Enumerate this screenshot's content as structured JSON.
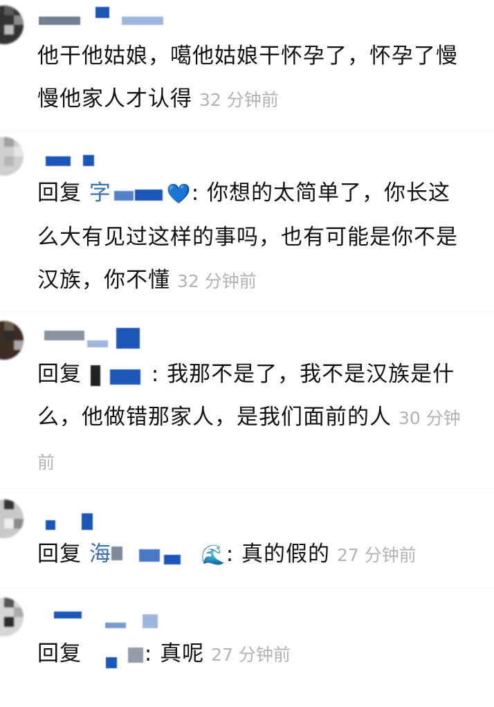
{
  "comments": [
    {
      "text": "他干他姑娘，噶他姑娘干怀孕了，怀孕了慢慢他家人才认得",
      "time": "32 分钟前"
    },
    {
      "reply_label": "回复",
      "reply_target_char": "字",
      "reply_emoji": "💙",
      "text": ": 你想的太简单了，你长这么大有见过这样的事吗，也有可能是你不是汉族，你不懂",
      "time": "32 分钟前"
    },
    {
      "reply_label": "回复",
      "text": ": 我那不是了，我不是汉族是什么，他做错那家人，是我们面前的人",
      "time": "30 分钟前"
    },
    {
      "reply_label": "回复",
      "reply_target_char": "海",
      "reply_emoji": "🌊",
      "text": ": 真的假的",
      "time": "27 分钟前"
    },
    {
      "reply_label": "回复",
      "text": ": 真呢",
      "time": "27 分钟前"
    }
  ],
  "colors": {
    "text": "#111111",
    "time": "#b3b3b3",
    "reply_target": "#3a6fb0",
    "mosaic_blue": "#1c57b8"
  }
}
